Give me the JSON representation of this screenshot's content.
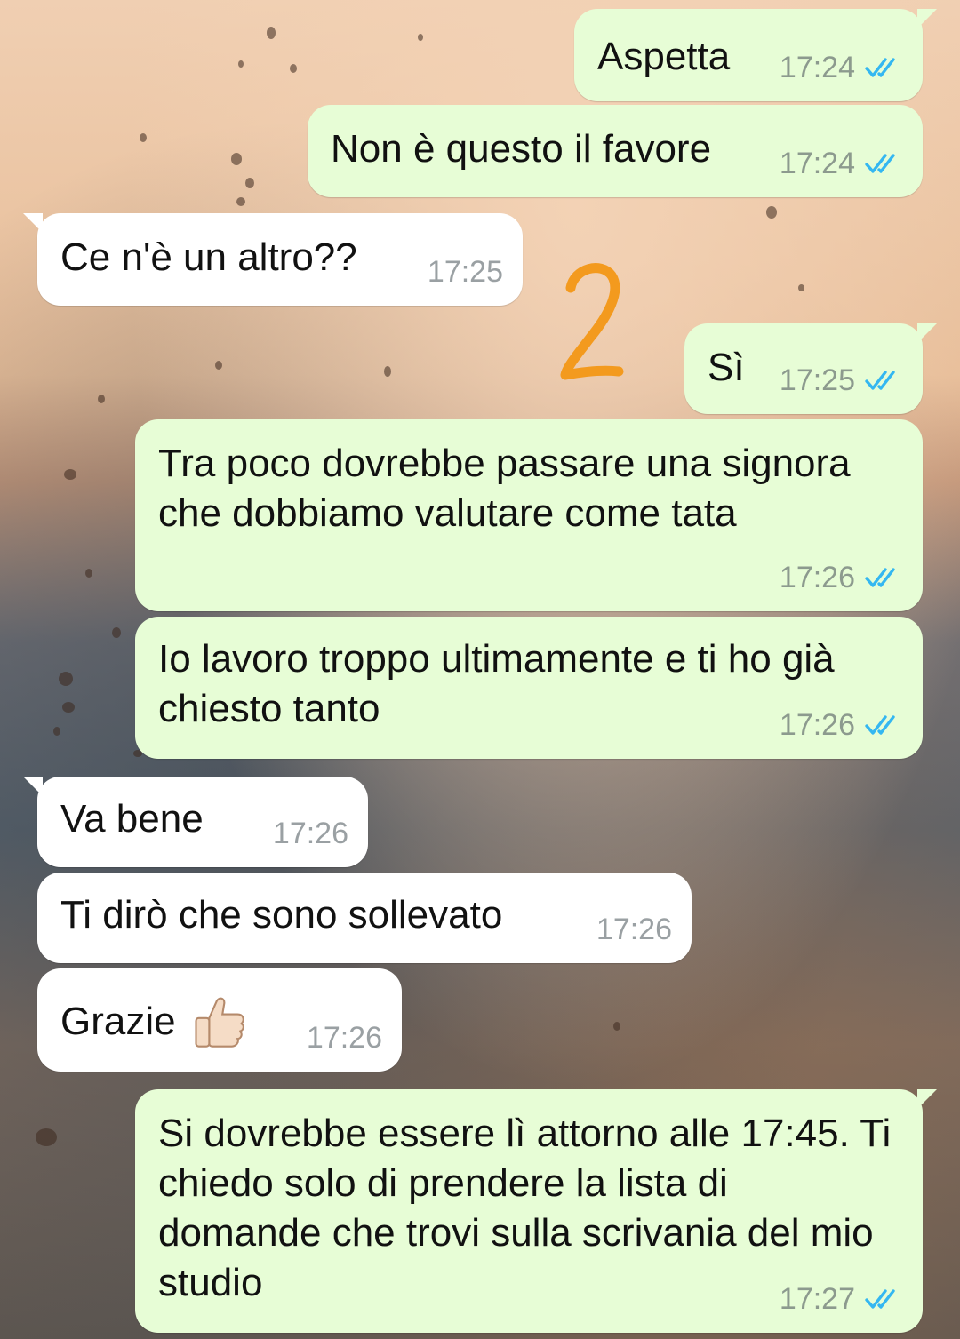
{
  "chat": {
    "messages": [
      {
        "direction": "outgoing",
        "text": "Aspetta",
        "time": "17:24",
        "status": "read"
      },
      {
        "direction": "outgoing",
        "text": "Non è questo il favore",
        "time": "17:24",
        "status": "read"
      },
      {
        "direction": "incoming",
        "text": "Ce n'è un altro??",
        "time": "17:25"
      },
      {
        "direction": "outgoing",
        "text": "Sì",
        "time": "17:25",
        "status": "read"
      },
      {
        "direction": "outgoing",
        "text": "Tra poco dovrebbe passare una signora che dobbiamo valutare come tata",
        "time": "17:26",
        "status": "read"
      },
      {
        "direction": "outgoing",
        "text": "Io lavoro troppo ultimamente e ti ho già chiesto tanto",
        "time": "17:26",
        "status": "read"
      },
      {
        "direction": "incoming",
        "text": "Va bene",
        "time": "17:26"
      },
      {
        "direction": "incoming",
        "text": "Ti dirò che sono sollevato",
        "time": "17:26"
      },
      {
        "direction": "incoming",
        "text": "Grazie",
        "time": "17:26",
        "emoji": "thumbs-up-light-skin"
      },
      {
        "direction": "outgoing",
        "text": "Si dovrebbe essere lì attorno alle 17:45. Ti chiedo solo di prendere la lista di domande che trovi sulla scrivania del mio studio",
        "time": "17:27",
        "status": "read"
      }
    ],
    "annotation_text": "2"
  },
  "colors": {
    "outgoing_bubble": "#e7fdd6",
    "incoming_bubble": "#ffffff",
    "read_ticks": "#34b7f1",
    "annotation": "#f39a1e"
  },
  "icons": {
    "read_status": "double-check-icon",
    "emoji": "thumbs-up-emoji"
  }
}
